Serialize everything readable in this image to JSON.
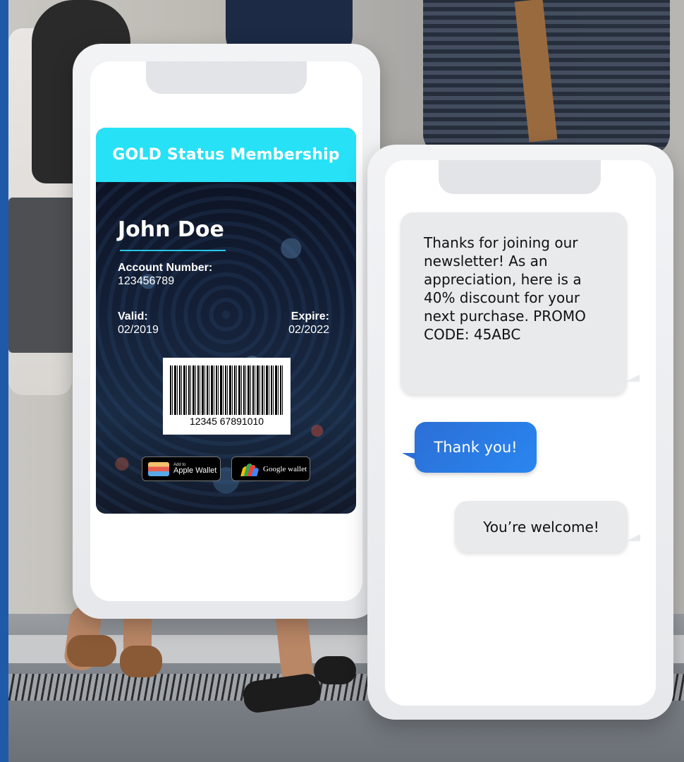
{
  "membership_card": {
    "title": "GOLD Status Membership",
    "member_name": "John Doe",
    "account_number_label": "Account Number:",
    "account_number": "123456789",
    "valid_label": "Valid:",
    "valid_date": "02/2019",
    "expire_label": "Expire:",
    "expire_date": "02/2022",
    "barcode_number": "12345 67891010",
    "apple_wallet_small": "Add to",
    "apple_wallet_label": "Apple Wallet",
    "google_wallet_label": "Google wallet",
    "header_color": "#27e1f6"
  },
  "chat": {
    "messages": [
      {
        "from": "business",
        "text": "Thanks for joining our newsletter! As an appreciation, here is a 40% discount for your next purchase. PROMO CODE: 45ABC"
      },
      {
        "from": "user",
        "text": "Thank you!"
      },
      {
        "from": "business",
        "text": "You’re welcome!"
      }
    ],
    "user_bubble_color": "#2b6fd6",
    "business_bubble_color": "#e9eaec"
  }
}
